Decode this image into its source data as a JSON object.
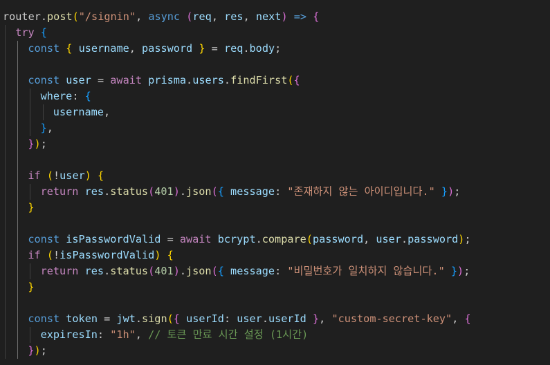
{
  "colors": {
    "background": "#1f1f1f",
    "plain": "#cccccc",
    "keyword": "#569cd6",
    "control": "#c586c0",
    "function": "#dcdcaa",
    "variable": "#9cdcfe",
    "string": "#ce9178",
    "number": "#b5cea8",
    "comment": "#6a9955",
    "bracket1": "#ffd700",
    "bracket2": "#da70d6",
    "bracket3": "#179fff",
    "punct": "#cccccc"
  },
  "code": {
    "lines": [
      {
        "indent": 0,
        "tokens": [
          {
            "t": "router",
            "c": "plain"
          },
          {
            "t": ".",
            "c": "plain"
          },
          {
            "t": "post",
            "c": "function"
          },
          {
            "t": "(",
            "c": "bracket1"
          },
          {
            "t": "\"/signin\"",
            "c": "string"
          },
          {
            "t": ", ",
            "c": "plain"
          },
          {
            "t": "async",
            "c": "keyword"
          },
          {
            "t": " ",
            "c": "plain"
          },
          {
            "t": "(",
            "c": "bracket2"
          },
          {
            "t": "req",
            "c": "variable"
          },
          {
            "t": ", ",
            "c": "plain"
          },
          {
            "t": "res",
            "c": "variable"
          },
          {
            "t": ", ",
            "c": "plain"
          },
          {
            "t": "next",
            "c": "variable"
          },
          {
            "t": ")",
            "c": "bracket2"
          },
          {
            "t": " ",
            "c": "plain"
          },
          {
            "t": "=>",
            "c": "keyword"
          },
          {
            "t": " ",
            "c": "plain"
          },
          {
            "t": "{",
            "c": "bracket2"
          }
        ]
      },
      {
        "indent": 1,
        "tokens": [
          {
            "t": "try",
            "c": "control"
          },
          {
            "t": " ",
            "c": "plain"
          },
          {
            "t": "{",
            "c": "bracket3"
          }
        ]
      },
      {
        "indent": 2,
        "tokens": [
          {
            "t": "const",
            "c": "keyword"
          },
          {
            "t": " ",
            "c": "plain"
          },
          {
            "t": "{",
            "c": "bracket1"
          },
          {
            "t": " ",
            "c": "plain"
          },
          {
            "t": "username",
            "c": "variable"
          },
          {
            "t": ", ",
            "c": "plain"
          },
          {
            "t": "password",
            "c": "variable"
          },
          {
            "t": " ",
            "c": "plain"
          },
          {
            "t": "}",
            "c": "bracket1"
          },
          {
            "t": " = ",
            "c": "plain"
          },
          {
            "t": "req",
            "c": "variable"
          },
          {
            "t": ".",
            "c": "plain"
          },
          {
            "t": "body",
            "c": "variable"
          },
          {
            "t": ";",
            "c": "plain"
          }
        ]
      },
      {
        "indent": 2,
        "tokens": []
      },
      {
        "indent": 2,
        "tokens": [
          {
            "t": "const",
            "c": "keyword"
          },
          {
            "t": " ",
            "c": "plain"
          },
          {
            "t": "user",
            "c": "variable"
          },
          {
            "t": " = ",
            "c": "plain"
          },
          {
            "t": "await",
            "c": "control"
          },
          {
            "t": " ",
            "c": "plain"
          },
          {
            "t": "prisma",
            "c": "variable"
          },
          {
            "t": ".",
            "c": "plain"
          },
          {
            "t": "users",
            "c": "variable"
          },
          {
            "t": ".",
            "c": "plain"
          },
          {
            "t": "findFirst",
            "c": "function"
          },
          {
            "t": "(",
            "c": "bracket1"
          },
          {
            "t": "{",
            "c": "bracket2"
          }
        ]
      },
      {
        "indent": 3,
        "tokens": [
          {
            "t": "where",
            "c": "variable"
          },
          {
            "t": ": ",
            "c": "plain"
          },
          {
            "t": "{",
            "c": "bracket3"
          }
        ]
      },
      {
        "indent": 4,
        "tokens": [
          {
            "t": "username",
            "c": "variable"
          },
          {
            "t": ",",
            "c": "plain"
          }
        ]
      },
      {
        "indent": 3,
        "tokens": [
          {
            "t": "}",
            "c": "bracket3"
          },
          {
            "t": ",",
            "c": "plain"
          }
        ]
      },
      {
        "indent": 2,
        "tokens": [
          {
            "t": "}",
            "c": "bracket2"
          },
          {
            "t": ")",
            "c": "bracket1"
          },
          {
            "t": ";",
            "c": "plain"
          }
        ]
      },
      {
        "indent": 2,
        "tokens": []
      },
      {
        "indent": 2,
        "tokens": [
          {
            "t": "if",
            "c": "control"
          },
          {
            "t": " ",
            "c": "plain"
          },
          {
            "t": "(",
            "c": "bracket1"
          },
          {
            "t": "!",
            "c": "plain"
          },
          {
            "t": "user",
            "c": "variable"
          },
          {
            "t": ")",
            "c": "bracket1"
          },
          {
            "t": " ",
            "c": "plain"
          },
          {
            "t": "{",
            "c": "bracket1"
          }
        ]
      },
      {
        "indent": 3,
        "tokens": [
          {
            "t": "return",
            "c": "control"
          },
          {
            "t": " ",
            "c": "plain"
          },
          {
            "t": "res",
            "c": "variable"
          },
          {
            "t": ".",
            "c": "plain"
          },
          {
            "t": "status",
            "c": "function"
          },
          {
            "t": "(",
            "c": "bracket2"
          },
          {
            "t": "401",
            "c": "number"
          },
          {
            "t": ")",
            "c": "bracket2"
          },
          {
            "t": ".",
            "c": "plain"
          },
          {
            "t": "json",
            "c": "function"
          },
          {
            "t": "(",
            "c": "bracket2"
          },
          {
            "t": "{",
            "c": "bracket3"
          },
          {
            "t": " ",
            "c": "plain"
          },
          {
            "t": "message",
            "c": "variable"
          },
          {
            "t": ": ",
            "c": "plain"
          },
          {
            "t": "\"존재하지 않는 아이디입니다.\"",
            "c": "string"
          },
          {
            "t": " ",
            "c": "plain"
          },
          {
            "t": "}",
            "c": "bracket3"
          },
          {
            "t": ")",
            "c": "bracket2"
          },
          {
            "t": ";",
            "c": "plain"
          }
        ]
      },
      {
        "indent": 2,
        "tokens": [
          {
            "t": "}",
            "c": "bracket1"
          }
        ]
      },
      {
        "indent": 2,
        "tokens": []
      },
      {
        "indent": 2,
        "tokens": [
          {
            "t": "const",
            "c": "keyword"
          },
          {
            "t": " ",
            "c": "plain"
          },
          {
            "t": "isPasswordValid",
            "c": "variable"
          },
          {
            "t": " = ",
            "c": "plain"
          },
          {
            "t": "await",
            "c": "control"
          },
          {
            "t": " ",
            "c": "plain"
          },
          {
            "t": "bcrypt",
            "c": "variable"
          },
          {
            "t": ".",
            "c": "plain"
          },
          {
            "t": "compare",
            "c": "function"
          },
          {
            "t": "(",
            "c": "bracket1"
          },
          {
            "t": "password",
            "c": "variable"
          },
          {
            "t": ", ",
            "c": "plain"
          },
          {
            "t": "user",
            "c": "variable"
          },
          {
            "t": ".",
            "c": "plain"
          },
          {
            "t": "password",
            "c": "variable"
          },
          {
            "t": ")",
            "c": "bracket1"
          },
          {
            "t": ";",
            "c": "plain"
          }
        ]
      },
      {
        "indent": 2,
        "tokens": [
          {
            "t": "if",
            "c": "control"
          },
          {
            "t": " ",
            "c": "plain"
          },
          {
            "t": "(",
            "c": "bracket1"
          },
          {
            "t": "!",
            "c": "plain"
          },
          {
            "t": "isPasswordValid",
            "c": "variable"
          },
          {
            "t": ")",
            "c": "bracket1"
          },
          {
            "t": " ",
            "c": "plain"
          },
          {
            "t": "{",
            "c": "bracket1"
          }
        ]
      },
      {
        "indent": 3,
        "tokens": [
          {
            "t": "return",
            "c": "control"
          },
          {
            "t": " ",
            "c": "plain"
          },
          {
            "t": "res",
            "c": "variable"
          },
          {
            "t": ".",
            "c": "plain"
          },
          {
            "t": "status",
            "c": "function"
          },
          {
            "t": "(",
            "c": "bracket2"
          },
          {
            "t": "401",
            "c": "number"
          },
          {
            "t": ")",
            "c": "bracket2"
          },
          {
            "t": ".",
            "c": "plain"
          },
          {
            "t": "json",
            "c": "function"
          },
          {
            "t": "(",
            "c": "bracket2"
          },
          {
            "t": "{",
            "c": "bracket3"
          },
          {
            "t": " ",
            "c": "plain"
          },
          {
            "t": "message",
            "c": "variable"
          },
          {
            "t": ": ",
            "c": "plain"
          },
          {
            "t": "\"비밀번호가 일치하지 않습니다.\"",
            "c": "string"
          },
          {
            "t": " ",
            "c": "plain"
          },
          {
            "t": "}",
            "c": "bracket3"
          },
          {
            "t": ")",
            "c": "bracket2"
          },
          {
            "t": ";",
            "c": "plain"
          }
        ]
      },
      {
        "indent": 2,
        "tokens": [
          {
            "t": "}",
            "c": "bracket1"
          }
        ]
      },
      {
        "indent": 2,
        "tokens": []
      },
      {
        "indent": 2,
        "tokens": [
          {
            "t": "const",
            "c": "keyword"
          },
          {
            "t": " ",
            "c": "plain"
          },
          {
            "t": "token",
            "c": "variable"
          },
          {
            "t": " = ",
            "c": "plain"
          },
          {
            "t": "jwt",
            "c": "variable"
          },
          {
            "t": ".",
            "c": "plain"
          },
          {
            "t": "sign",
            "c": "function"
          },
          {
            "t": "(",
            "c": "bracket1"
          },
          {
            "t": "{",
            "c": "bracket2"
          },
          {
            "t": " ",
            "c": "plain"
          },
          {
            "t": "userId",
            "c": "variable"
          },
          {
            "t": ": ",
            "c": "plain"
          },
          {
            "t": "user",
            "c": "variable"
          },
          {
            "t": ".",
            "c": "plain"
          },
          {
            "t": "userId",
            "c": "variable"
          },
          {
            "t": " ",
            "c": "plain"
          },
          {
            "t": "}",
            "c": "bracket2"
          },
          {
            "t": ", ",
            "c": "plain"
          },
          {
            "t": "\"custom-secret-key\"",
            "c": "string"
          },
          {
            "t": ", ",
            "c": "plain"
          },
          {
            "t": "{",
            "c": "bracket2"
          }
        ]
      },
      {
        "indent": 3,
        "tokens": [
          {
            "t": "expiresIn",
            "c": "variable"
          },
          {
            "t": ": ",
            "c": "plain"
          },
          {
            "t": "\"1h\"",
            "c": "string"
          },
          {
            "t": ", ",
            "c": "plain"
          },
          {
            "t": "// 토큰 만료 시간 설정 (1시간)",
            "c": "comment"
          }
        ]
      },
      {
        "indent": 2,
        "tokens": [
          {
            "t": "}",
            "c": "bracket2"
          },
          {
            "t": ")",
            "c": "bracket1"
          },
          {
            "t": ";",
            "c": "plain"
          }
        ]
      }
    ]
  }
}
